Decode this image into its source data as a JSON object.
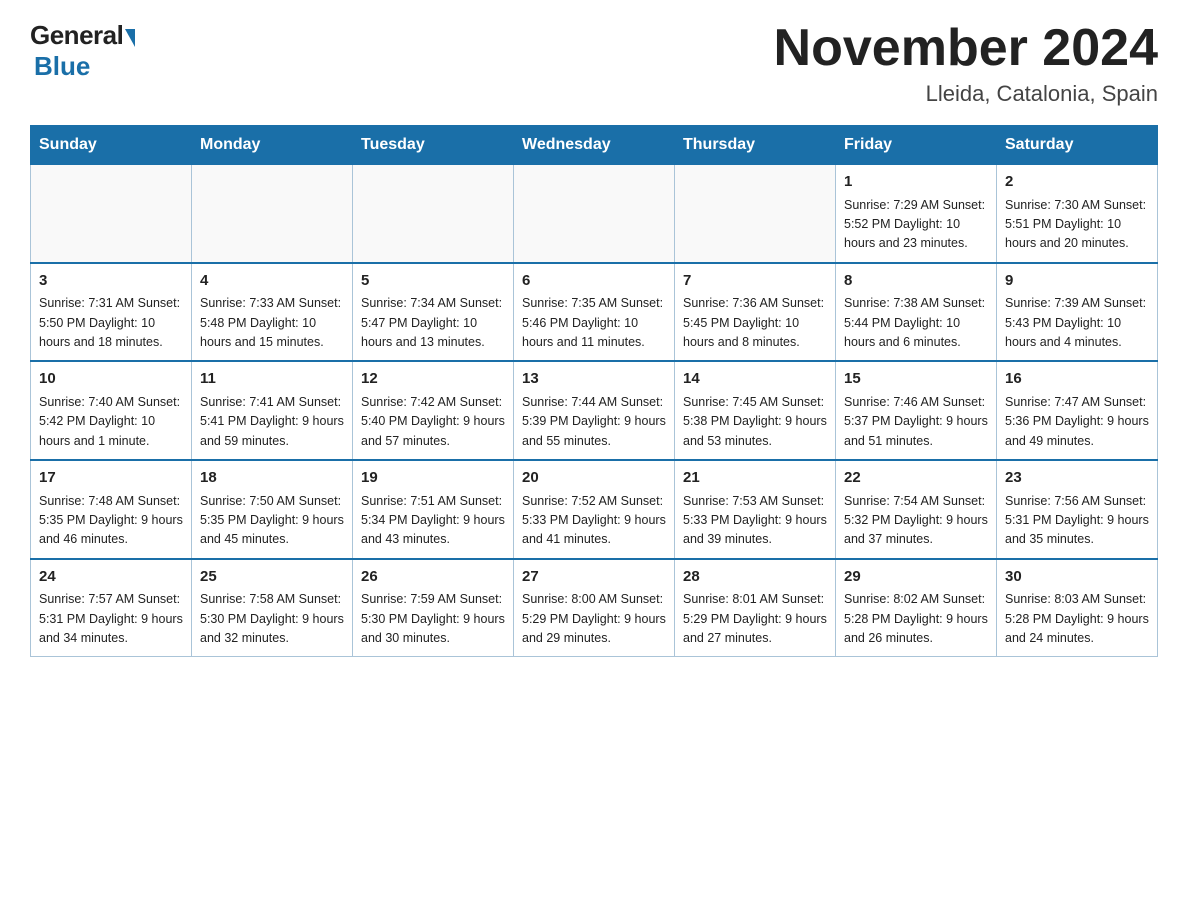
{
  "header": {
    "logo_general": "General",
    "logo_blue": "Blue",
    "month_title": "November 2024",
    "location": "Lleida, Catalonia, Spain"
  },
  "weekdays": [
    "Sunday",
    "Monday",
    "Tuesday",
    "Wednesday",
    "Thursday",
    "Friday",
    "Saturday"
  ],
  "weeks": [
    {
      "days": [
        {
          "number": "",
          "info": ""
        },
        {
          "number": "",
          "info": ""
        },
        {
          "number": "",
          "info": ""
        },
        {
          "number": "",
          "info": ""
        },
        {
          "number": "",
          "info": ""
        },
        {
          "number": "1",
          "info": "Sunrise: 7:29 AM\nSunset: 5:52 PM\nDaylight: 10 hours\nand 23 minutes."
        },
        {
          "number": "2",
          "info": "Sunrise: 7:30 AM\nSunset: 5:51 PM\nDaylight: 10 hours\nand 20 minutes."
        }
      ]
    },
    {
      "days": [
        {
          "number": "3",
          "info": "Sunrise: 7:31 AM\nSunset: 5:50 PM\nDaylight: 10 hours\nand 18 minutes."
        },
        {
          "number": "4",
          "info": "Sunrise: 7:33 AM\nSunset: 5:48 PM\nDaylight: 10 hours\nand 15 minutes."
        },
        {
          "number": "5",
          "info": "Sunrise: 7:34 AM\nSunset: 5:47 PM\nDaylight: 10 hours\nand 13 minutes."
        },
        {
          "number": "6",
          "info": "Sunrise: 7:35 AM\nSunset: 5:46 PM\nDaylight: 10 hours\nand 11 minutes."
        },
        {
          "number": "7",
          "info": "Sunrise: 7:36 AM\nSunset: 5:45 PM\nDaylight: 10 hours\nand 8 minutes."
        },
        {
          "number": "8",
          "info": "Sunrise: 7:38 AM\nSunset: 5:44 PM\nDaylight: 10 hours\nand 6 minutes."
        },
        {
          "number": "9",
          "info": "Sunrise: 7:39 AM\nSunset: 5:43 PM\nDaylight: 10 hours\nand 4 minutes."
        }
      ]
    },
    {
      "days": [
        {
          "number": "10",
          "info": "Sunrise: 7:40 AM\nSunset: 5:42 PM\nDaylight: 10 hours\nand 1 minute."
        },
        {
          "number": "11",
          "info": "Sunrise: 7:41 AM\nSunset: 5:41 PM\nDaylight: 9 hours\nand 59 minutes."
        },
        {
          "number": "12",
          "info": "Sunrise: 7:42 AM\nSunset: 5:40 PM\nDaylight: 9 hours\nand 57 minutes."
        },
        {
          "number": "13",
          "info": "Sunrise: 7:44 AM\nSunset: 5:39 PM\nDaylight: 9 hours\nand 55 minutes."
        },
        {
          "number": "14",
          "info": "Sunrise: 7:45 AM\nSunset: 5:38 PM\nDaylight: 9 hours\nand 53 minutes."
        },
        {
          "number": "15",
          "info": "Sunrise: 7:46 AM\nSunset: 5:37 PM\nDaylight: 9 hours\nand 51 minutes."
        },
        {
          "number": "16",
          "info": "Sunrise: 7:47 AM\nSunset: 5:36 PM\nDaylight: 9 hours\nand 49 minutes."
        }
      ]
    },
    {
      "days": [
        {
          "number": "17",
          "info": "Sunrise: 7:48 AM\nSunset: 5:35 PM\nDaylight: 9 hours\nand 46 minutes."
        },
        {
          "number": "18",
          "info": "Sunrise: 7:50 AM\nSunset: 5:35 PM\nDaylight: 9 hours\nand 45 minutes."
        },
        {
          "number": "19",
          "info": "Sunrise: 7:51 AM\nSunset: 5:34 PM\nDaylight: 9 hours\nand 43 minutes."
        },
        {
          "number": "20",
          "info": "Sunrise: 7:52 AM\nSunset: 5:33 PM\nDaylight: 9 hours\nand 41 minutes."
        },
        {
          "number": "21",
          "info": "Sunrise: 7:53 AM\nSunset: 5:33 PM\nDaylight: 9 hours\nand 39 minutes."
        },
        {
          "number": "22",
          "info": "Sunrise: 7:54 AM\nSunset: 5:32 PM\nDaylight: 9 hours\nand 37 minutes."
        },
        {
          "number": "23",
          "info": "Sunrise: 7:56 AM\nSunset: 5:31 PM\nDaylight: 9 hours\nand 35 minutes."
        }
      ]
    },
    {
      "days": [
        {
          "number": "24",
          "info": "Sunrise: 7:57 AM\nSunset: 5:31 PM\nDaylight: 9 hours\nand 34 minutes."
        },
        {
          "number": "25",
          "info": "Sunrise: 7:58 AM\nSunset: 5:30 PM\nDaylight: 9 hours\nand 32 minutes."
        },
        {
          "number": "26",
          "info": "Sunrise: 7:59 AM\nSunset: 5:30 PM\nDaylight: 9 hours\nand 30 minutes."
        },
        {
          "number": "27",
          "info": "Sunrise: 8:00 AM\nSunset: 5:29 PM\nDaylight: 9 hours\nand 29 minutes."
        },
        {
          "number": "28",
          "info": "Sunrise: 8:01 AM\nSunset: 5:29 PM\nDaylight: 9 hours\nand 27 minutes."
        },
        {
          "number": "29",
          "info": "Sunrise: 8:02 AM\nSunset: 5:28 PM\nDaylight: 9 hours\nand 26 minutes."
        },
        {
          "number": "30",
          "info": "Sunrise: 8:03 AM\nSunset: 5:28 PM\nDaylight: 9 hours\nand 24 minutes."
        }
      ]
    }
  ]
}
